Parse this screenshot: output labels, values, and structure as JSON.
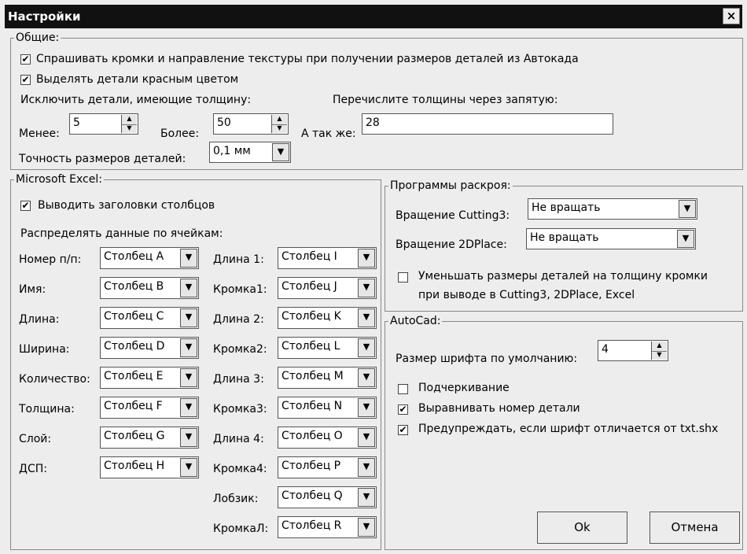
{
  "window": {
    "title": "Настройки",
    "close": "×"
  },
  "general": {
    "legend": "Общие:",
    "ask_edges": {
      "checked": true,
      "label": "Спрашивать кромки и направление текстуры при получении размеров деталей из Автокада"
    },
    "highlight_red": {
      "checked": true,
      "label": "Выделять детали красным цветом"
    },
    "exclude_label": "Исключить детали, имеющие толщину:",
    "list_label": "Перечислите толщины через запятую:",
    "less_label": "Менее:",
    "less_value": "5",
    "more_label": "Более:",
    "more_value": "50",
    "also_label": "А так же:",
    "also_value": "28",
    "precision_label": "Точность размеров деталей:",
    "precision_value": "0,1 мм"
  },
  "excel": {
    "legend": "Microsoft Excel:",
    "headers": {
      "checked": true,
      "label": "Выводить заголовки столбцов"
    },
    "distribute_label": "Распределять данные по ячейкам:",
    "left_rows": [
      {
        "label": "Номер п/п:",
        "value": "Столбец A"
      },
      {
        "label": "Имя:",
        "value": "Столбец B"
      },
      {
        "label": "Длина:",
        "value": "Столбец C"
      },
      {
        "label": "Ширина:",
        "value": "Столбец D"
      },
      {
        "label": "Количество:",
        "value": "Столбец E"
      },
      {
        "label": "Толщина:",
        "value": "Столбец F"
      },
      {
        "label": "Слой:",
        "value": "Столбец G"
      },
      {
        "label": "ДСП:",
        "value": "Столбец H"
      }
    ],
    "right_rows": [
      {
        "label": "Длина 1:",
        "value": "Столбец I"
      },
      {
        "label": "Кромка1:",
        "value": "Столбец J"
      },
      {
        "label": "Длина 2:",
        "value": "Столбец K"
      },
      {
        "label": "Кромка2:",
        "value": "Столбец L"
      },
      {
        "label": "Длина 3:",
        "value": "Столбец M"
      },
      {
        "label": "Кромка3:",
        "value": "Столбец N"
      },
      {
        "label": "Длина 4:",
        "value": "Столбец O"
      },
      {
        "label": "Кромка4:",
        "value": "Столбец P"
      },
      {
        "label": "Лобзик:",
        "value": "Столбец Q"
      },
      {
        "label": "КромкаЛ:",
        "value": "Столбец R"
      }
    ]
  },
  "cutting": {
    "legend": "Программы раскроя:",
    "cutting3_label": "Вращение Cutting3:",
    "cutting3_value": "Не вращать",
    "place2d_label": "Вращение 2DPlace:",
    "place2d_value": "Не вращать",
    "reduce": {
      "checked": false,
      "label1": "Уменьшать размеры деталей на толщину кромки",
      "label2": "при выводе в Cutting3, 2DPlace, Excel"
    }
  },
  "autocad": {
    "legend": "AutoCad:",
    "font_label": "Размер шрифта по умолчанию:",
    "font_value": "4",
    "underline": {
      "checked": false,
      "label": "Подчеркивание"
    },
    "align": {
      "checked": true,
      "label": "Выравнивать номер детали"
    },
    "warn": {
      "checked": true,
      "label": "Предупреждать, если шрифт отличается от txt.shx"
    }
  },
  "buttons": {
    "ok": "Ok",
    "cancel": "Отмена"
  }
}
